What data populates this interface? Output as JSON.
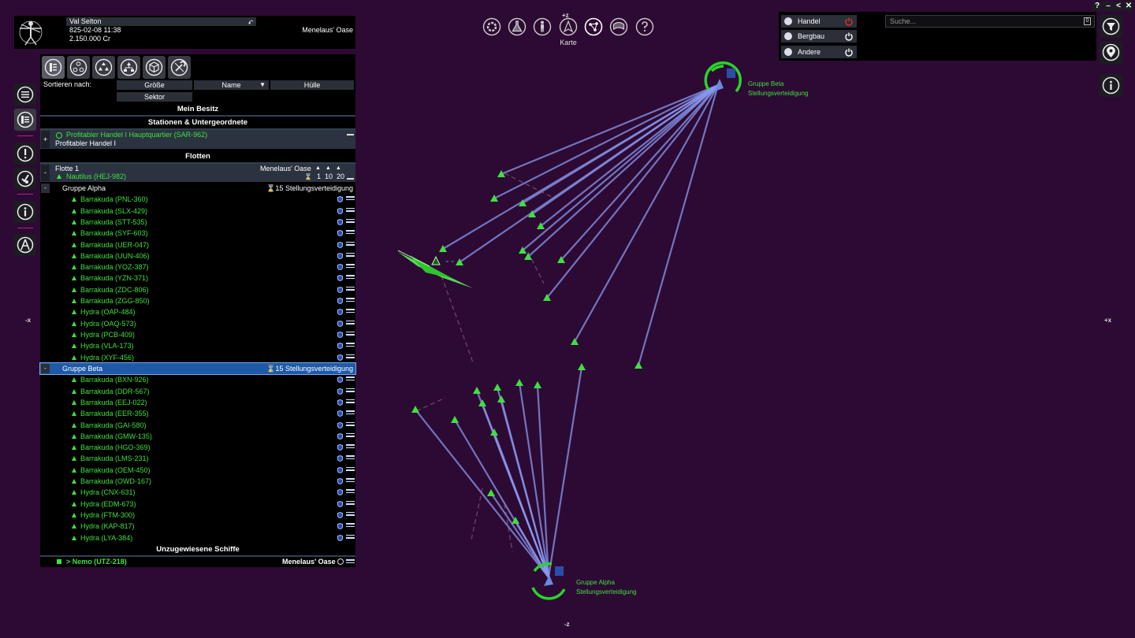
{
  "player": {
    "name": "Val Selton",
    "datetime": "825-02-08 11:38",
    "credits": "2.150.000 Cr",
    "location": "Menelaus' Oase"
  },
  "sidebar": [
    "menu-icon",
    "info-panel-icon",
    "alert-icon",
    "mission-icon",
    "info-icon",
    "compass-icon"
  ],
  "tabs": [
    "objects-icon",
    "fleet-icon",
    "group-icon",
    "tree-icon",
    "cube-icon",
    "wrench-icon"
  ],
  "sort": {
    "label": "Sortieren nach:",
    "options": [
      "Größe",
      "Name",
      "Hülle",
      "Sektor"
    ]
  },
  "sections": {
    "owned": "Mein Besitz",
    "stations": "Stationen & Untergeordnete",
    "fleets": "Flotten",
    "unassigned": "Unzugewiesene Schiffe"
  },
  "station": {
    "name": "Profitabler Handel I Hauptquartier (SAR-962)",
    "sub": "Profitabler Handel I",
    "toggle": "+"
  },
  "fleet": {
    "name": "Flotte 1",
    "location": "Menelaus' Oase",
    "commander": "Nautilus (HEJ-982)",
    "counts": [
      "1",
      "10",
      "20"
    ],
    "toggle": "-"
  },
  "groups": [
    {
      "name": "Gruppe Alpha",
      "count": "15",
      "order": "Stellungsverteidigung",
      "toggle": "-",
      "ships": [
        "Barrakuda (PNL-360)",
        "Barrakuda (SLX-429)",
        "Barrakuda (STT-535)",
        "Barrakuda (SYF-603)",
        "Barrakuda (UER-047)",
        "Barrakuda (UUN-406)",
        "Barrakuda (YOZ-387)",
        "Barrakuda (YZN-371)",
        "Barrakuda (ZDC-806)",
        "Barrakuda (ZGG-850)",
        "Hydra (OAP-484)",
        "Hydra (OAQ-573)",
        "Hydra (PCB-409)",
        "Hydra (VLA-173)",
        "Hydra (XYF-456)"
      ]
    },
    {
      "name": "Gruppe Beta",
      "count": "15",
      "order": "Stellungsverteidigung",
      "toggle": "-",
      "ships": [
        "Barrakuda (BXN-926)",
        "Barrakuda (DDR-567)",
        "Barrakuda (EEJ-022)",
        "Barrakuda (EER-355)",
        "Barrakuda (GAI-580)",
        "Barrakuda (GMW-135)",
        "Barrakuda (HGO-369)",
        "Barrakuda (LMS-231)",
        "Barrakuda (OEM-450)",
        "Barrakuda (OWD-167)",
        "Hydra (CNX-631)",
        "Hydra (EDM-673)",
        "Hydra (FTM-300)",
        "Hydra (KAP-817)",
        "Hydra (LYA-384)"
      ]
    }
  ],
  "unassigned_ship": {
    "name": "> Nemo (UTZ-218)",
    "location": "Menelaus' Oase"
  },
  "topbar": {
    "icons": [
      "settings-icon",
      "flask-icon",
      "person-icon",
      "ship-icon",
      "map-icon",
      "encyclopedia-icon",
      "help-icon"
    ],
    "active_label": "Karte",
    "active_sup": "+z"
  },
  "filters": [
    {
      "label": "Handel",
      "on": false
    },
    {
      "label": "Bergbau",
      "on": true
    },
    {
      "label": "Andere",
      "on": true
    }
  ],
  "search": {
    "placeholder": "Suche...",
    "clear": "0"
  },
  "window": {
    "help": "?",
    "min": "–",
    "back": "<",
    "close": "✕"
  },
  "axes": {
    "neg_x": "-x",
    "pos_x": "+x",
    "neg_z": "-z"
  },
  "map": {
    "beta": {
      "name": "Gruppe Beta",
      "order": "Stellungsverteidigung"
    },
    "alpha": {
      "name": "Gruppe Alpha",
      "order": "Stellungsverteidigung"
    }
  },
  "colors": {
    "background": "#2d0a33",
    "accent_green": "#3fe03f",
    "selection_blue": "#1e5aa8",
    "beam": "#7f8fe6"
  }
}
